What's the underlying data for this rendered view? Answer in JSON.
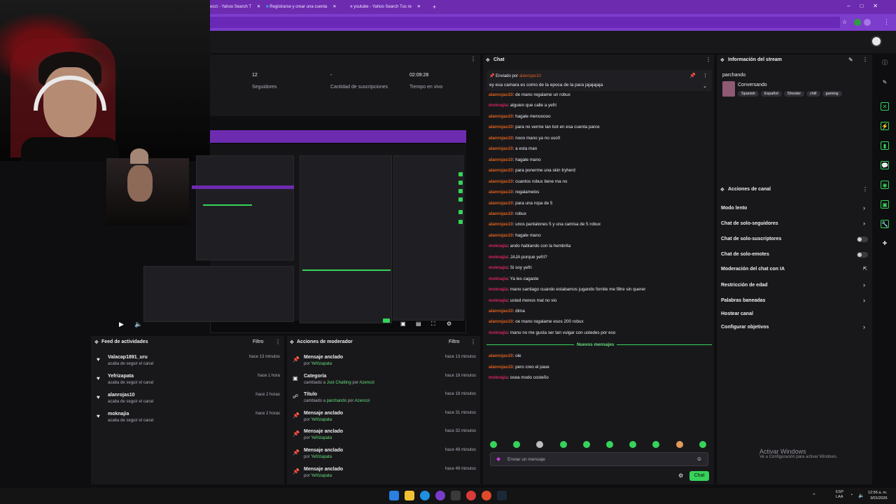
{
  "browser": {
    "tabs": [
      {
        "label": "ecct - Yahoo Search T"
      },
      {
        "label": "Registrarse y crear una cuenta"
      },
      {
        "label": "youtube - Yahoo Search Tus re"
      }
    ],
    "new_tab": "+"
  },
  "stats": [
    {
      "value": "12",
      "label": "Seguidores"
    },
    {
      "value": "-",
      "label": "Cantidad de suscripciones"
    },
    {
      "value": "02:09:28",
      "label": "Tiempo en vivo"
    }
  ],
  "activity_feed": {
    "title": "Feed de actividades",
    "filter": "Filtro",
    "items": [
      {
        "name": "Valacap1891_uru",
        "sub": "acaba de seguir el canal",
        "time": "hace 13 minutos"
      },
      {
        "name": "Yefrizapata",
        "sub": "acaba de seguir el canal",
        "time": "hace 1 hora"
      },
      {
        "name": "alanrojas10",
        "sub": "acaba de seguir el canal",
        "time": "hace 2 horas"
      },
      {
        "name": "moknajia",
        "sub": "acaba de seguir el canal",
        "time": "hace 2 horas"
      }
    ]
  },
  "mod_actions": {
    "title": "Acciones de moderador",
    "filter": "Filtro",
    "items": [
      {
        "name": "Mensaje anclado",
        "pre": "por ",
        "who": "Yefrizapata",
        "mid": "",
        "who2": "",
        "time": "hace 13 minutos",
        "icon": "pin-icon"
      },
      {
        "name": "Categoría",
        "pre": "cambiado a ",
        "who": "Just Chatting",
        "mid": " por ",
        "who2": "Azencol",
        "time": "hace 18 minutos",
        "icon": "category-icon"
      },
      {
        "name": "Título",
        "pre": "cambiado a ",
        "who": "parchando",
        "mid": " por ",
        "who2": "Azencol",
        "time": "hace 18 minutos",
        "icon": "title-icon"
      },
      {
        "name": "Mensaje anclado",
        "pre": "por ",
        "who": "Yefrizapata",
        "mid": "",
        "who2": "",
        "time": "hace 31 minutos",
        "icon": "pin-icon"
      },
      {
        "name": "Mensaje anclado",
        "pre": "por ",
        "who": "Yefrizapata",
        "mid": "",
        "who2": "",
        "time": "hace 32 minutos",
        "icon": "pin-icon"
      },
      {
        "name": "Mensaje anclado",
        "pre": "por ",
        "who": "Yefrizapata",
        "mid": "",
        "who2": "",
        "time": "hace 49 minutos",
        "icon": "pin-icon"
      },
      {
        "name": "Mensaje anclado",
        "pre": "por ",
        "who": "Yefrizapata",
        "mid": "",
        "who2": "",
        "time": "hace 49 minutos",
        "icon": "pin-icon"
      }
    ]
  },
  "chat": {
    "title": "Chat",
    "pinned": {
      "by_label": "Enviado por",
      "by_user": "alanrojas10",
      "text": "ey esa camara es como de la epoca de la para jajajajaja"
    },
    "messages_before": [
      {
        "user": "alanrojas10",
        "color": "#e0621b",
        "text": ": de mano regalame un robux"
      },
      {
        "user": "moknajia",
        "color": "#d6245a",
        "text": ": alguien que calle a yefri"
      },
      {
        "user": "alanrojas10",
        "color": "#e0621b",
        "text": ": hagale menooooo"
      },
      {
        "user": "alanrojas10",
        "color": "#e0621b",
        "text": ": para no verme tan bot en esa cuenta parce"
      },
      {
        "user": "alanrojas10",
        "color": "#e0621b",
        "text": ": nooo mano ya no uso0"
      },
      {
        "user": "alanrojas10",
        "color": "#e0621b",
        "text": ": a esta man"
      },
      {
        "user": "alanrojas10",
        "color": "#e0621b",
        "text": ": hagale mano"
      },
      {
        "user": "alanrojas10",
        "color": "#e0621b",
        "text": ": para ponerme una skin tryherd"
      },
      {
        "user": "alanrojas10",
        "color": "#e0621b",
        "text": ": cuantos robux tiene ma no"
      },
      {
        "user": "alanrojas10",
        "color": "#e0621b",
        "text": ": regalamelos"
      },
      {
        "user": "alanrojas10",
        "color": "#e0621b",
        "text": ": para una ropa de 5"
      },
      {
        "user": "alanrojas10",
        "color": "#e0621b",
        "text": ": robux"
      },
      {
        "user": "alanrojas10",
        "color": "#e0621b",
        "text": ": unos pantalones 5 y una camisa de 5 robux"
      },
      {
        "user": "alanrojas10",
        "color": "#e0621b",
        "text": ": hagale mano"
      },
      {
        "user": "moknajia",
        "color": "#d6245a",
        "text": ": ando hablando con la hembrita"
      },
      {
        "user": "moknajia",
        "color": "#d6245a",
        "text": ": JAJA porque yefri?"
      },
      {
        "user": "moknajia",
        "color": "#d6245a",
        "text": ": Si soy yefri"
      },
      {
        "user": "moknajia",
        "color": "#d6245a",
        "text": ": Ya les cagaste"
      },
      {
        "user": "moknajia",
        "color": "#d6245a",
        "text": ": mano santiago cuando estabamos jugando fornite me filtre sin querer"
      },
      {
        "user": "moknajia",
        "color": "#d6245a",
        "text": ": usted menos mal no vio"
      },
      {
        "user": "alanrojas10",
        "color": "#e0621b",
        "text": ": dima"
      },
      {
        "user": "alanrojas10",
        "color": "#e0621b",
        "text": ": oe mano regalame esos 200 robux"
      },
      {
        "user": "moknajia",
        "color": "#d6245a",
        "text": ": mano no me gusta ser tan vulgar con ustedes por eso"
      }
    ],
    "new_messages_label": "Nuevos mensajes",
    "messages_after": [
      {
        "user": "alanrojas10",
        "color": "#e0621b",
        "text": ": ole"
      },
      {
        "user": "alanrojas10",
        "color": "#e0621b",
        "text": ": pero creo el pase"
      },
      {
        "user": "moknajia",
        "color": "#d6245a",
        "text": ": osea modo costeño"
      }
    ],
    "input_placeholder": "Enviar un mensaje",
    "send_button": "Chat"
  },
  "stream_info": {
    "title": "Información del stream",
    "stream_title": "parchando",
    "category": "Conversando",
    "tags": [
      "Spanish",
      "Español",
      "Shooter",
      "chill",
      "gaming"
    ]
  },
  "channel_actions": {
    "title": "Acciones de canal",
    "items": [
      {
        "label": "Modo lento",
        "control": "chevron"
      },
      {
        "label": "Chat de solo-seguidores",
        "control": "chevron"
      },
      {
        "label": "Chat de solo-suscriptores",
        "control": "toggle"
      },
      {
        "label": "Chat de solo-emotes",
        "control": "toggle"
      },
      {
        "label": "Moderación del chat con IA",
        "control": "external"
      },
      {
        "label": "Restricción de edad",
        "control": "chevron"
      },
      {
        "label": "Palabras baneadas",
        "control": "chevron"
      },
      {
        "label": "Hostear canal",
        "control": "none"
      },
      {
        "label": "Configurar objetivos",
        "control": "chevron"
      }
    ]
  },
  "windows_activation": {
    "title": "Activar Windows",
    "sub": "Ve a Configuración para activar Windows."
  },
  "taskbar": {
    "lang": "ESP",
    "lang2": "LAA",
    "time": "12:56 a. m.",
    "date": "3/01/2026"
  }
}
